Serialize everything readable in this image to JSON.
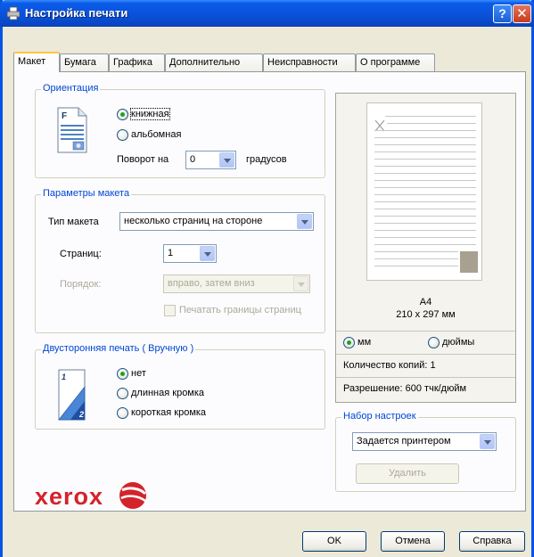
{
  "window": {
    "title": "Настройка печати"
  },
  "tabs": [
    {
      "label": "Макет",
      "active": true
    },
    {
      "label": "Бумага",
      "active": false
    },
    {
      "label": "Графика",
      "active": false
    },
    {
      "label": "Дополнительно",
      "active": false
    },
    {
      "label": "Неисправности",
      "active": false
    },
    {
      "label": "О программе",
      "active": false
    }
  ],
  "orientation": {
    "title": "Ориентация",
    "portrait": "книжная",
    "landscape": "альбомная",
    "rotate_label": "Поворот на",
    "rotate_value": "0",
    "rotate_unit": "градусов",
    "selected": "portrait"
  },
  "layout": {
    "title": "Параметры макета",
    "type_label": "Тип макета",
    "type_value": "несколько страниц на стороне",
    "pages_label": "Страниц:",
    "pages_value": "1",
    "order_label": "Порядок:",
    "order_value": "вправо, затем вниз",
    "borders_label": "Печатать границы страниц"
  },
  "duplex": {
    "title": "Двусторонняя печать ( Вручную )",
    "none": "нет",
    "long_edge": "длинная кромка",
    "short_edge": "короткая кромка",
    "selected": "none"
  },
  "preview": {
    "paper": "A4",
    "dimensions": "210 x 297 мм",
    "unit_mm": "мм",
    "unit_inch": "дюймы",
    "unit_selected": "mm",
    "copies": "Количество копий: 1",
    "resolution": "Разрешение: 600 тчк/дюйм"
  },
  "preset": {
    "title": "Набор настроек",
    "value": "Задается принтером",
    "delete_label": "Удалить"
  },
  "buttons": {
    "ok": "OK",
    "cancel": "Отмена",
    "help": "Справка"
  },
  "brand": {
    "logo_text": "xerox",
    "color": "#d4232a"
  },
  "colors": {
    "titlebar": "#0a53dd",
    "group_title": "#0046d5",
    "tab_highlight": "#ffc83c"
  },
  "icons": {
    "title": "printer-icon",
    "help": "help-icon",
    "close": "close-icon",
    "orientation": "portrait-page-icon",
    "duplex": "duplex-page-icon",
    "logo": "xerox-sphere-icon"
  }
}
